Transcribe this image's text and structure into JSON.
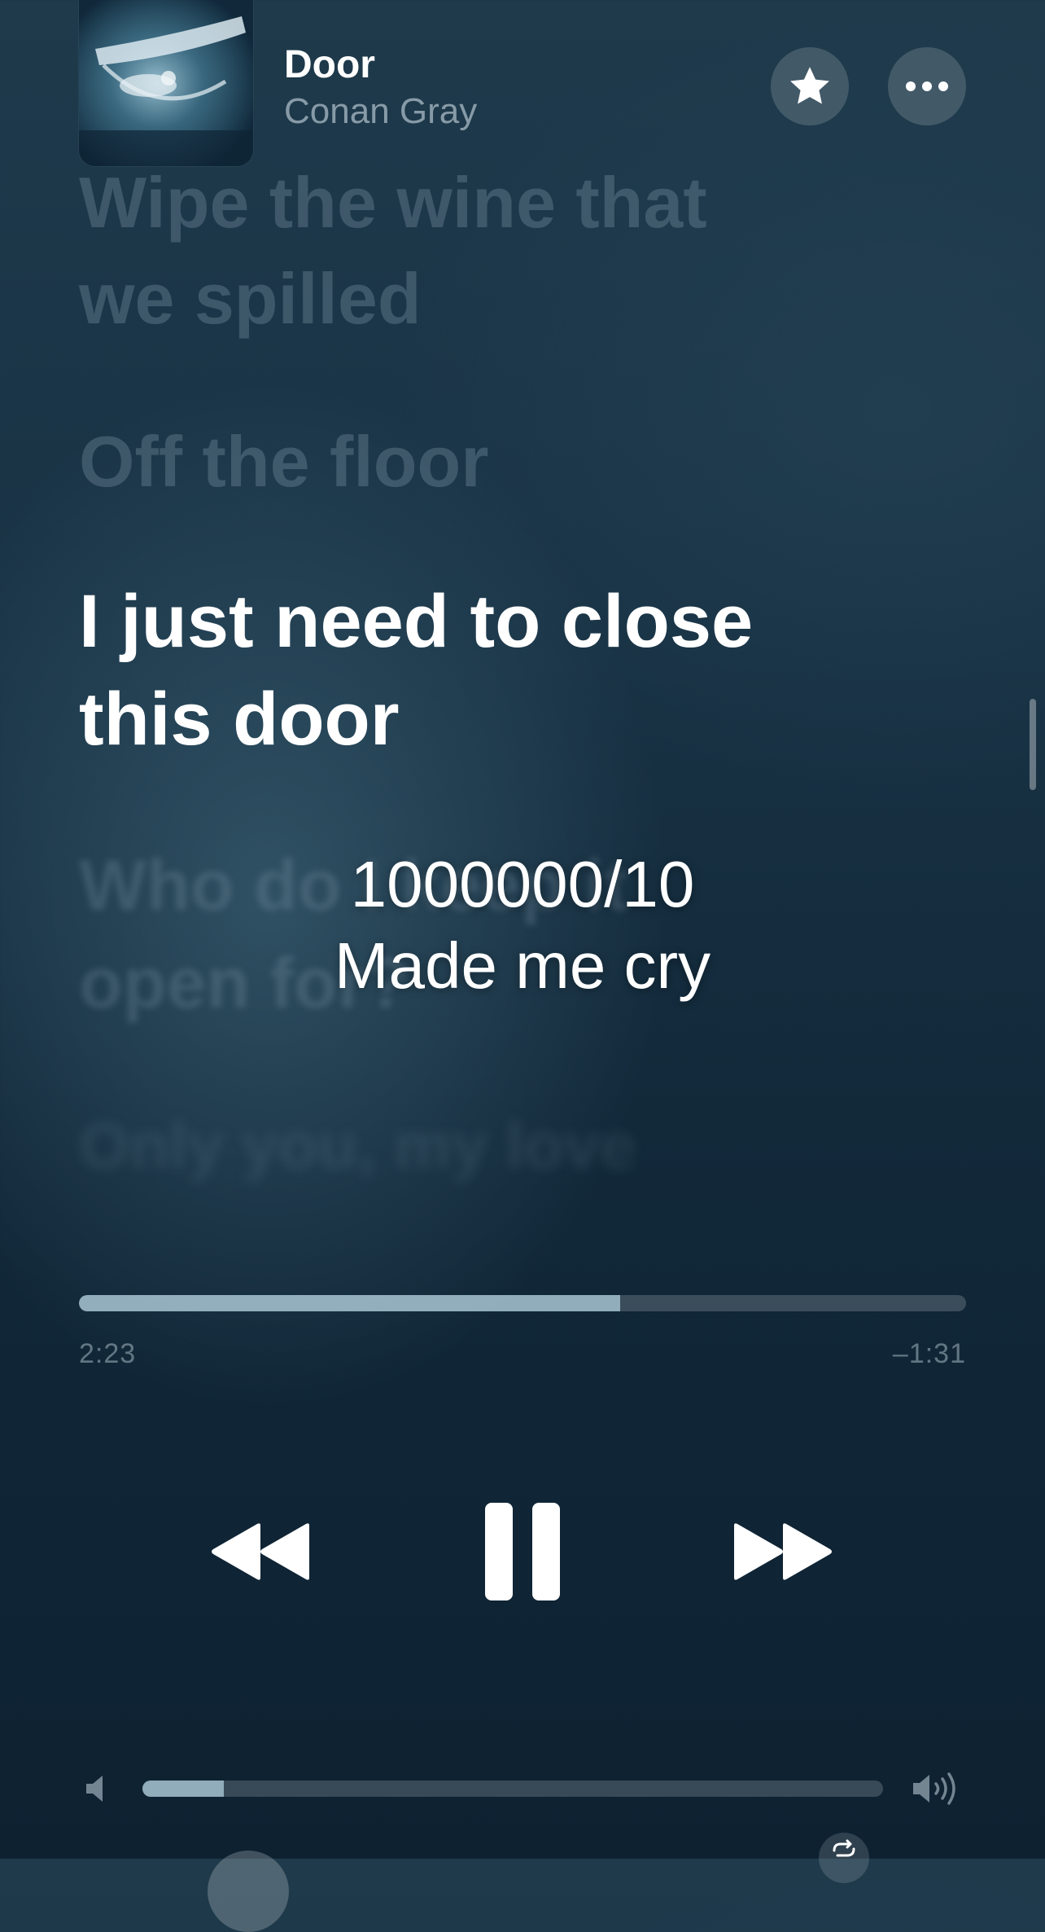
{
  "now_playing": {
    "title": "Door",
    "artist": "Conan Gray"
  },
  "header_buttons": {
    "favorite_icon": "star-icon",
    "more_icon": "ellipsis-icon"
  },
  "lyrics": {
    "past": [
      "Wipe the wine that",
      "we spilled",
      "Off the floor"
    ],
    "current": [
      "I just need to close",
      "this door"
    ],
    "upcoming": [
      "Who do I keep it",
      "open for?",
      "Only you, my love"
    ]
  },
  "overlay_caption": {
    "line1": "1000000/10",
    "line2": "Made me cry"
  },
  "playback": {
    "elapsed": "2:23",
    "remaining": "–1:31",
    "progress_fraction": 0.61
  },
  "transport": {
    "rewind_icon": "rewind-icon",
    "pause_icon": "pause-icon",
    "forward_icon": "fast-forward-icon"
  },
  "volume": {
    "level_fraction": 0.11,
    "low_icon": "speaker-low-icon",
    "high_icon": "speaker-high-icon"
  },
  "colors": {
    "background_top": "#1e3a4b",
    "background_bottom": "#0d2131",
    "accent": "#ffffff"
  }
}
